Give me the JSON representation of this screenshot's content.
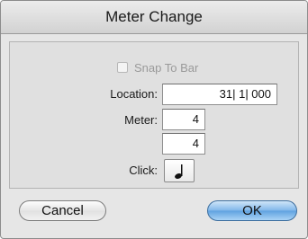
{
  "window": {
    "title": "Meter Change"
  },
  "snap_to_bar": {
    "label": "Snap To Bar",
    "checked": false
  },
  "location": {
    "label": "Location:",
    "value": "31| 1| 000"
  },
  "meter": {
    "label": "Meter:",
    "numerator": "4",
    "denominator": "4"
  },
  "click": {
    "label": "Click:",
    "note_icon": "quarter-note-icon"
  },
  "buttons": {
    "cancel_label": "Cancel",
    "ok_label": "OK"
  }
}
